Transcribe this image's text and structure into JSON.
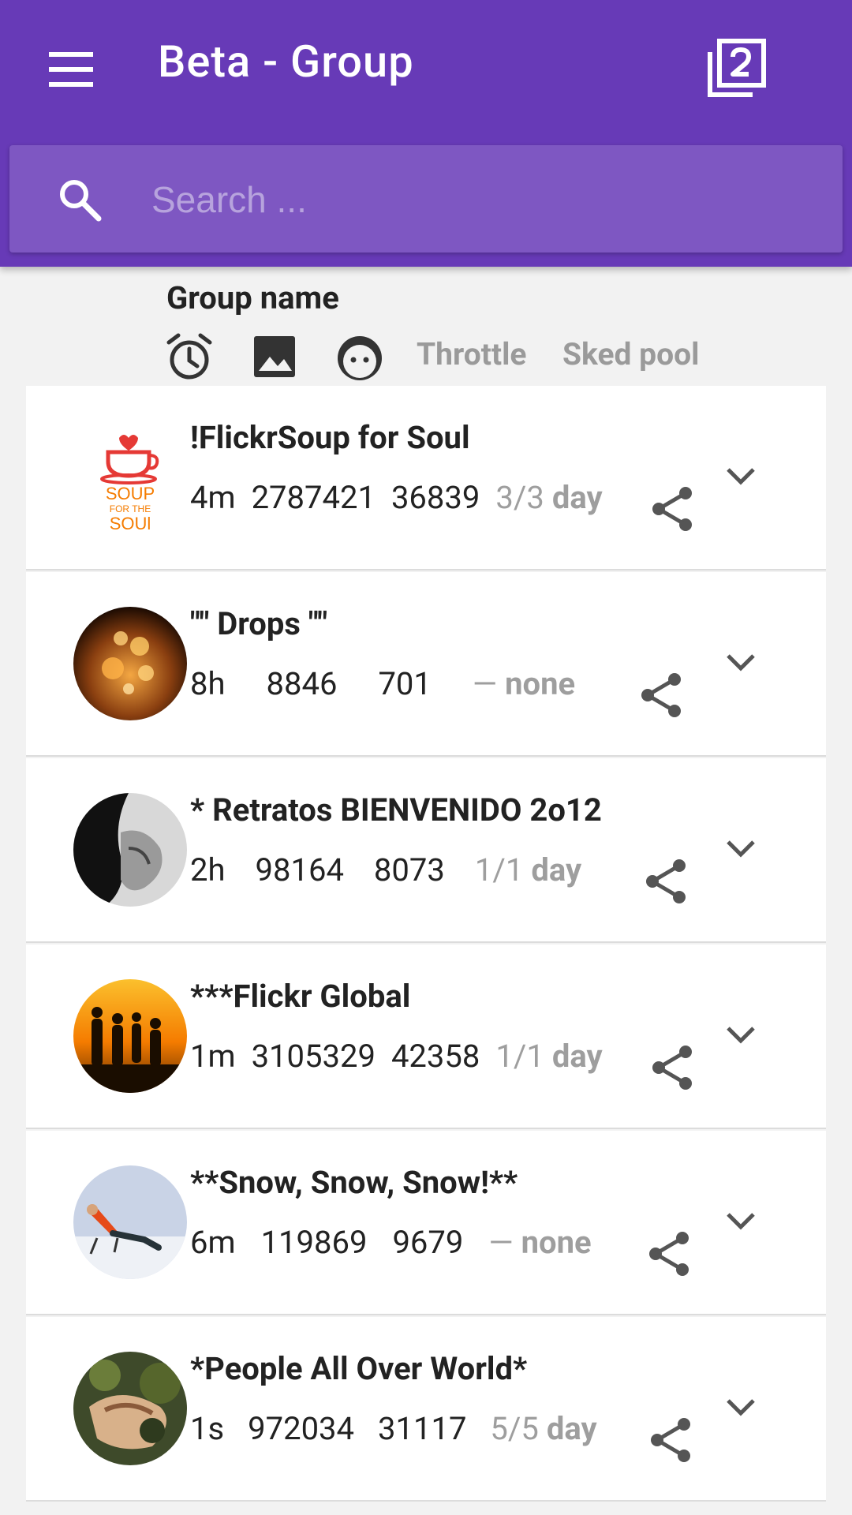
{
  "appbar": {
    "title": "Beta - Group",
    "menu_icon": "hamburger-menu-icon",
    "pages_icon": "filter-2-icon"
  },
  "search": {
    "placeholder": "Search ...",
    "value": "",
    "icon": "search-icon"
  },
  "header": {
    "group_name_label": "Group name",
    "icons": [
      "alarm-clock-icon",
      "image-icon",
      "face-icon"
    ],
    "throttle_label": "Throttle",
    "sked_pool_label": "Sked pool"
  },
  "groups": [
    {
      "name": "!FlickrSoup for Soul",
      "age": "4m",
      "members": "2787421",
      "photos": "36839",
      "throttle_count": "3/3",
      "throttle_unit": "day",
      "avatar": "soup-logo"
    },
    {
      "name": "\"\" Drops \"\"",
      "age": "8h",
      "members": "8846",
      "photos": "701",
      "throttle_count": "—",
      "throttle_unit": "none",
      "avatar": "drops-photo"
    },
    {
      "name": "* Retratos BIENVENIDO 2o12",
      "age": "2h",
      "members": "98164",
      "photos": "8073",
      "throttle_count": "1/1",
      "throttle_unit": "day",
      "avatar": "portrait-photo"
    },
    {
      "name": "***Flickr Global",
      "age": "1m",
      "members": "3105329",
      "photos": "42358",
      "throttle_count": "1/1",
      "throttle_unit": "day",
      "avatar": "silhouettes-photo"
    },
    {
      "name": "**Snow, Snow, Snow!**",
      "age": "6m",
      "members": "119869",
      "photos": "9679",
      "throttle_count": "—",
      "throttle_unit": "none",
      "avatar": "snow-photo"
    },
    {
      "name": "*People All Over World*",
      "age": "1s",
      "members": "972034",
      "photos": "31117",
      "throttle_count": "5/5",
      "throttle_unit": "day",
      "avatar": "person-photo"
    }
  ]
}
